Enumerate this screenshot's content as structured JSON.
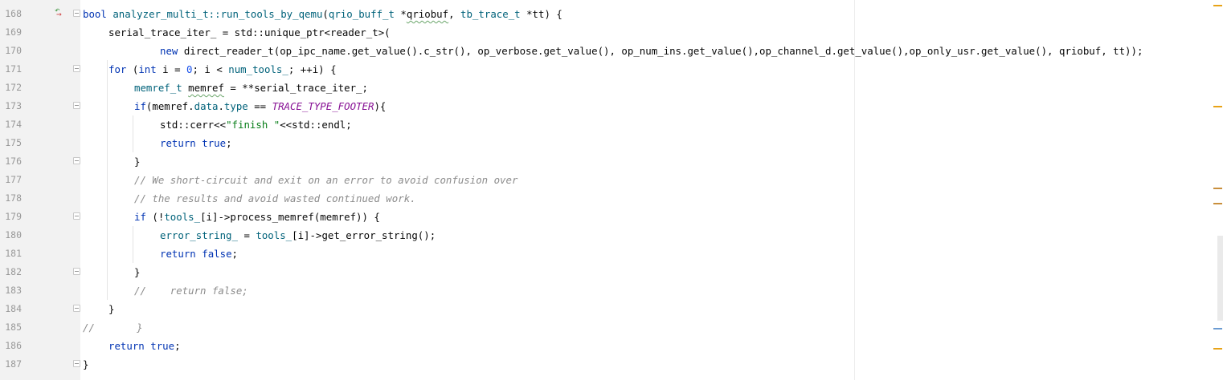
{
  "editor": {
    "lines": [
      {
        "number": "168",
        "fold": true,
        "indent": 0,
        "change_icon": true,
        "tokens": [
          {
            "t": "bool",
            "c": "kw"
          },
          {
            "t": " "
          },
          {
            "t": "analyzer_multi_t::",
            "c": "fn"
          },
          {
            "t": "run_tools_by_qemu",
            "c": "fn"
          },
          {
            "t": "("
          },
          {
            "t": "qrio_buff_t",
            "c": "fn"
          },
          {
            "t": " *"
          },
          {
            "t": "qriobuf",
            "c": "squig"
          },
          {
            "t": ", "
          },
          {
            "t": "tb_trace_t",
            "c": "fn"
          },
          {
            "t": " *tt) {"
          }
        ]
      },
      {
        "number": "169",
        "fold": false,
        "indent": 1,
        "tokens": [
          {
            "t": "serial_trace_iter_ = std::unique_ptr<reader_t>("
          }
        ]
      },
      {
        "number": "170",
        "fold": false,
        "indent": 3,
        "tokens": [
          {
            "t": "new",
            "c": "kw"
          },
          {
            "t": " direct_reader_t(op_ipc_name.get_value().c_str(), op_verbose.get_value(), op_num_ins.get_value(),op_channel_d.get_value(),op_only_usr.get_value(), qriobuf, tt));"
          }
        ]
      },
      {
        "number": "171",
        "fold": true,
        "indent": 1,
        "tokens": [
          {
            "t": "for",
            "c": "kw"
          },
          {
            "t": " ("
          },
          {
            "t": "int",
            "c": "kw"
          },
          {
            "t": " i = "
          },
          {
            "t": "0",
            "c": "num"
          },
          {
            "t": "; i < "
          },
          {
            "t": "num_tools_",
            "c": "fn"
          },
          {
            "t": "; ++i) {"
          }
        ]
      },
      {
        "number": "172",
        "fold": false,
        "indent": 2,
        "tokens": [
          {
            "t": "memref_t",
            "c": "fn"
          },
          {
            "t": " "
          },
          {
            "t": "memref",
            "c": "squig"
          },
          {
            "t": " = **serial_trace_iter_;"
          }
        ]
      },
      {
        "number": "173",
        "fold": true,
        "indent": 2,
        "tokens": [
          {
            "t": "if",
            "c": "kw"
          },
          {
            "t": "(memref."
          },
          {
            "t": "data",
            "c": "fn"
          },
          {
            "t": "."
          },
          {
            "t": "type",
            "c": "fn"
          },
          {
            "t": " == "
          },
          {
            "t": "TRACE_TYPE_FOOTER",
            "c": "mac"
          },
          {
            "t": "){"
          }
        ]
      },
      {
        "number": "174",
        "fold": false,
        "indent": 3,
        "tokens": [
          {
            "t": "std::cerr<<"
          },
          {
            "t": "\"finish \"",
            "c": "str"
          },
          {
            "t": "<<std::endl;"
          }
        ]
      },
      {
        "number": "175",
        "fold": false,
        "indent": 3,
        "tokens": [
          {
            "t": "return",
            "c": "kw"
          },
          {
            "t": " "
          },
          {
            "t": "true",
            "c": "kw"
          },
          {
            "t": ";"
          }
        ]
      },
      {
        "number": "176",
        "fold": true,
        "indent": 2,
        "tokens": [
          {
            "t": "}"
          }
        ]
      },
      {
        "number": "177",
        "fold": false,
        "indent": 2,
        "tokens": [
          {
            "t": "// We short-circuit and exit on an error to avoid confusion over",
            "c": "cm"
          }
        ]
      },
      {
        "number": "178",
        "fold": false,
        "indent": 2,
        "tokens": [
          {
            "t": "// the results and avoid wasted continued work.",
            "c": "cm"
          }
        ]
      },
      {
        "number": "179",
        "fold": true,
        "indent": 2,
        "tokens": [
          {
            "t": "if",
            "c": "kw"
          },
          {
            "t": " (!"
          },
          {
            "t": "tools_",
            "c": "fn"
          },
          {
            "t": "[i]->process_memref(memref)) {"
          }
        ]
      },
      {
        "number": "180",
        "fold": false,
        "indent": 3,
        "tokens": [
          {
            "t": "error_string_",
            "c": "fn"
          },
          {
            "t": " = "
          },
          {
            "t": "tools_",
            "c": "fn"
          },
          {
            "t": "[i]->get_error_string();"
          }
        ]
      },
      {
        "number": "181",
        "fold": false,
        "indent": 3,
        "tokens": [
          {
            "t": "return",
            "c": "kw"
          },
          {
            "t": " "
          },
          {
            "t": "false",
            "c": "kw"
          },
          {
            "t": ";"
          }
        ]
      },
      {
        "number": "182",
        "fold": true,
        "indent": 2,
        "tokens": [
          {
            "t": "}"
          }
        ]
      },
      {
        "number": "183",
        "fold": false,
        "indent": 2,
        "tokens": [
          {
            "t": "//    return false;",
            "c": "cm"
          }
        ]
      },
      {
        "number": "184",
        "fold": true,
        "indent": 1,
        "tokens": [
          {
            "t": "}"
          }
        ]
      },
      {
        "number": "185",
        "fold": false,
        "indent": 0,
        "tokens": [
          {
            "t": "//       }",
            "c": "cm"
          }
        ]
      },
      {
        "number": "186",
        "fold": false,
        "indent": 1,
        "tokens": [
          {
            "t": "return",
            "c": "kw"
          },
          {
            "t": " "
          },
          {
            "t": "true",
            "c": "kw"
          },
          {
            "t": ";"
          }
        ]
      },
      {
        "number": "187",
        "fold": true,
        "indent": 0,
        "tokens": [
          {
            "t": "}"
          }
        ]
      }
    ],
    "change_icon": "change-arrows-icon",
    "scroll_markers": [
      {
        "color": "#e8a317"
      },
      {
        "color": "#e8a317"
      },
      {
        "color": "#c98f3c"
      },
      {
        "color": "#c98f3c"
      },
      {
        "color": "#6b9bd2"
      },
      {
        "color": "#e8a317"
      }
    ],
    "colors": {
      "keyword": "#0033b3",
      "function": "#00627a",
      "string": "#067d17",
      "number": "#1750eb",
      "comment": "#8c8c8c",
      "macro": "#871094"
    }
  }
}
